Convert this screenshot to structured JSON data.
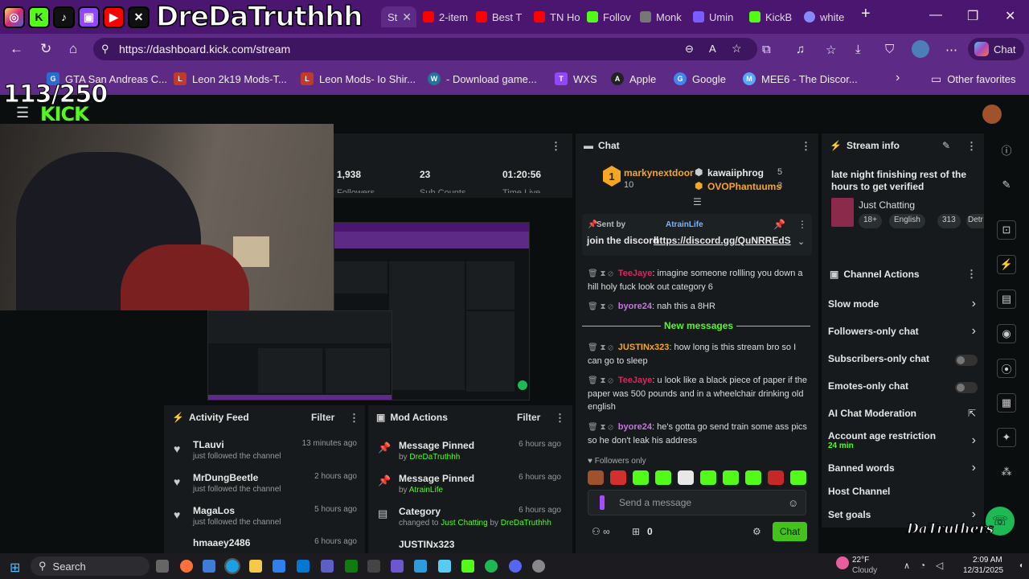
{
  "overlay": {
    "handle": "DreDaTruthhh",
    "sub_count": "113/250",
    "kick_logo": "KICK",
    "watermark": "DaTruthers"
  },
  "tabs": [
    {
      "label": "St",
      "color": "#53fc18"
    },
    {
      "label": "2-item",
      "color": "#ff0000"
    },
    {
      "label": "Best T",
      "color": "#ff0000"
    },
    {
      "label": "TN Ho",
      "color": "#ff0000"
    },
    {
      "label": "Follov",
      "color": "#53fc18"
    },
    {
      "label": "Monk",
      "color": "#777777"
    },
    {
      "label": "Umin",
      "color": "#7b5cff"
    },
    {
      "label": "KickB",
      "color": "#53fc18"
    },
    {
      "label": "white",
      "color": "#8888ff"
    }
  ],
  "address": {
    "url": "https://dashboard.kick.com/stream",
    "chat_label": "Chat"
  },
  "bookmarks": [
    {
      "label": "GTA San Andreas C...",
      "color": "#2a6cd6",
      "glyph": "G"
    },
    {
      "label": "Leon 2k19 Mods-T...",
      "color": "#c0392b",
      "glyph": "L"
    },
    {
      "label": "Leon Mods- Io Shir...",
      "color": "#c0392b",
      "glyph": "L"
    },
    {
      "label": "- Download game...",
      "color": "#21759b",
      "glyph": "W"
    },
    {
      "label": "WXS",
      "color": "#9146ff",
      "glyph": "T"
    },
    {
      "label": "Apple",
      "color": "#222222",
      "glyph": "A"
    },
    {
      "label": "Google",
      "color": "#4285f4",
      "glyph": "G"
    },
    {
      "label": "MEE6 - The Discor...",
      "color": "#53a8ff",
      "glyph": "M"
    }
  ],
  "other_favorites": "Other favorites",
  "stats": {
    "s1": "1,938",
    "s2": "23",
    "s3": "01:20:56",
    "l1": "Followers",
    "l2": "Sub Counts",
    "l3": "Time Live"
  },
  "activity_feed": {
    "title": "Activity Feed",
    "filter": "Filter",
    "items": [
      {
        "name": "TLauvi",
        "sub": "just followed the channel",
        "time": "13 minutes ago"
      },
      {
        "name": "MrDungBeetle",
        "sub": "just followed the channel",
        "time": "2 hours ago"
      },
      {
        "name": "MagaLos",
        "sub": "just followed the channel",
        "time": "5 hours ago"
      },
      {
        "name": "hmaaey2486",
        "sub": "",
        "time": "6 hours ago"
      }
    ]
  },
  "mod_actions": {
    "title": "Mod Actions",
    "filter": "Filter",
    "items": [
      {
        "title": "Message Pinned",
        "by": "by",
        "user": "DreDaTruthhh",
        "time": "6 hours ago"
      },
      {
        "title": "Message Pinned",
        "by": "by",
        "user": "AtrainLife",
        "time": "6 hours ago"
      },
      {
        "title": "Category",
        "by": "changed to",
        "user": "Just Chatting",
        "by2": "by",
        "user2": "DreDaTruthhh",
        "time": "6 hours ago"
      },
      {
        "title": "JUSTINx323",
        "by": "",
        "user": "",
        "time": ""
      }
    ]
  },
  "chat": {
    "title": "Chat",
    "leaders": [
      {
        "rank": "1",
        "name": "markynextdoor",
        "count": "10"
      },
      {
        "name": "kawaiiphrog",
        "count": "5"
      },
      {
        "name": "OVOPhantuums",
        "count": "3"
      }
    ],
    "pinned": {
      "sent_by": "Sent by",
      "user": "AtrainLife",
      "text": "join the discord",
      "link": "https://discord.gg/QuNRREdS"
    },
    "messages": [
      {
        "user": "TeeJaye",
        "color": "#e0245e",
        "text": "imagine someone rollling you down a hill holy fuck look out category 6"
      },
      {
        "user": "byore24",
        "color": "#c678dd",
        "text": "nah this a 8HR"
      },
      {
        "user": "JUSTINx323",
        "color": "#f5a623",
        "text": "how long is this stream bro so I can go to sleep"
      },
      {
        "user": "TeeJaye",
        "color": "#e0245e",
        "text": "u look like a black piece of paper if the paper was 500 pounds and in a wheelchair drinking old english"
      },
      {
        "user": "byore24",
        "color": "#c678dd",
        "text": "he's gotta go send train some ass pics so he don't leak his address"
      }
    ],
    "new_messages": "New messages",
    "followers_only": "Followers only",
    "placeholder": "Send a message",
    "viewers": "0",
    "send_label": "Chat"
  },
  "stream_info": {
    "title": "Stream info",
    "stream_title": "late night finishing rest of the hours to get verified",
    "category": "Just Chatting",
    "tags": [
      "18+",
      "English",
      "313",
      "Detr"
    ]
  },
  "channel_actions": {
    "title": "Channel Actions",
    "items": [
      {
        "label": "Slow mode",
        "kind": "arrow"
      },
      {
        "label": "Followers-only chat",
        "kind": "arrow"
      },
      {
        "label": "Subscribers-only chat",
        "kind": "toggle"
      },
      {
        "label": "Emotes-only chat",
        "kind": "toggle"
      },
      {
        "label": "AI Chat Moderation",
        "kind": "ext"
      },
      {
        "label": "Account age restriction",
        "sub": "24 min",
        "kind": "arrow"
      },
      {
        "label": "Banned words",
        "kind": "arrow"
      },
      {
        "label": "Host Channel",
        "kind": "none"
      },
      {
        "label": "Set goals",
        "kind": "arrow"
      }
    ]
  },
  "taskbar": {
    "search": "Search",
    "weather_temp": "22°F",
    "weather_desc": "Cloudy",
    "time": "2:09 AM",
    "date": "12/31/2025"
  }
}
